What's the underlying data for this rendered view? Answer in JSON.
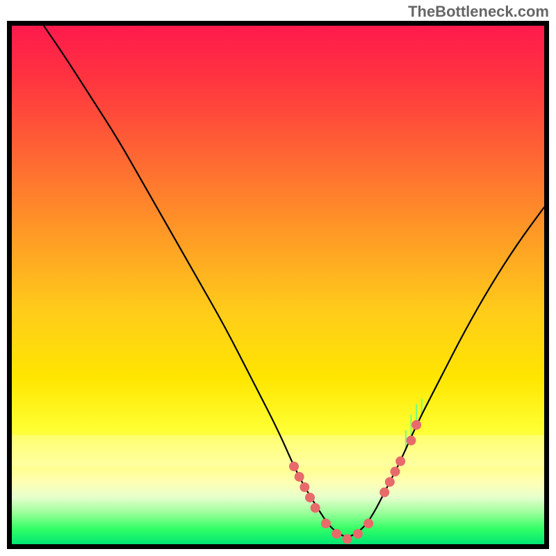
{
  "watermark": "TheBottleneck.com",
  "chart_data": {
    "type": "line",
    "title": "",
    "xlabel": "",
    "ylabel": "",
    "xlim": [
      0,
      100
    ],
    "ylim": [
      0,
      100
    ],
    "gradient_stops": [
      {
        "offset": 0.0,
        "color": "#ff1a4d"
      },
      {
        "offset": 0.1,
        "color": "#ff3340"
      },
      {
        "offset": 0.25,
        "color": "#ff6633"
      },
      {
        "offset": 0.4,
        "color": "#ff9926"
      },
      {
        "offset": 0.55,
        "color": "#ffcc1a"
      },
      {
        "offset": 0.68,
        "color": "#ffe600"
      },
      {
        "offset": 0.78,
        "color": "#ffff33"
      },
      {
        "offset": 0.84,
        "color": "#ffff80"
      },
      {
        "offset": 0.88,
        "color": "#ffffb3"
      },
      {
        "offset": 0.91,
        "color": "#e6ffcc"
      },
      {
        "offset": 0.94,
        "color": "#99ff99"
      },
      {
        "offset": 0.97,
        "color": "#33ff66"
      },
      {
        "offset": 1.0,
        "color": "#00e673"
      }
    ],
    "curve": {
      "comment": "V-shaped bottleneck curve. y=100 is top, y=0 is bottom. Steeper asymmetric valley, min near x≈63.",
      "x": [
        6,
        10,
        15,
        20,
        25,
        30,
        35,
        40,
        45,
        50,
        53,
        55,
        58,
        60,
        63,
        66,
        68,
        70,
        73,
        76,
        80,
        85,
        90,
        95,
        100
      ],
      "y": [
        100,
        94,
        86,
        78,
        69,
        60,
        51,
        42,
        32,
        22,
        15,
        11,
        6,
        3,
        1,
        3,
        6,
        10,
        16,
        23,
        31,
        41,
        50,
        58,
        65
      ]
    },
    "markers": {
      "color": "#e86a6a",
      "radius": 7,
      "points": [
        {
          "x": 53,
          "y": 15
        },
        {
          "x": 54,
          "y": 13
        },
        {
          "x": 55,
          "y": 11
        },
        {
          "x": 56,
          "y": 9
        },
        {
          "x": 57,
          "y": 7
        },
        {
          "x": 59,
          "y": 4
        },
        {
          "x": 61,
          "y": 2
        },
        {
          "x": 63,
          "y": 1
        },
        {
          "x": 65,
          "y": 2
        },
        {
          "x": 67,
          "y": 4
        },
        {
          "x": 70,
          "y": 10
        },
        {
          "x": 71,
          "y": 12
        },
        {
          "x": 72,
          "y": 14
        },
        {
          "x": 73,
          "y": 16
        },
        {
          "x": 75,
          "y": 20
        },
        {
          "x": 76,
          "y": 23
        }
      ]
    },
    "bars": {
      "comment": "small upward green spikes around x≈74-78",
      "color": "#6fff8a",
      "items": [
        {
          "x": 74,
          "y0": 18,
          "y1": 22
        },
        {
          "x": 75,
          "y0": 20,
          "y1": 25
        },
        {
          "x": 76,
          "y0": 23,
          "y1": 27
        },
        {
          "x": 77,
          "y0": 25,
          "y1": 28
        }
      ]
    }
  }
}
